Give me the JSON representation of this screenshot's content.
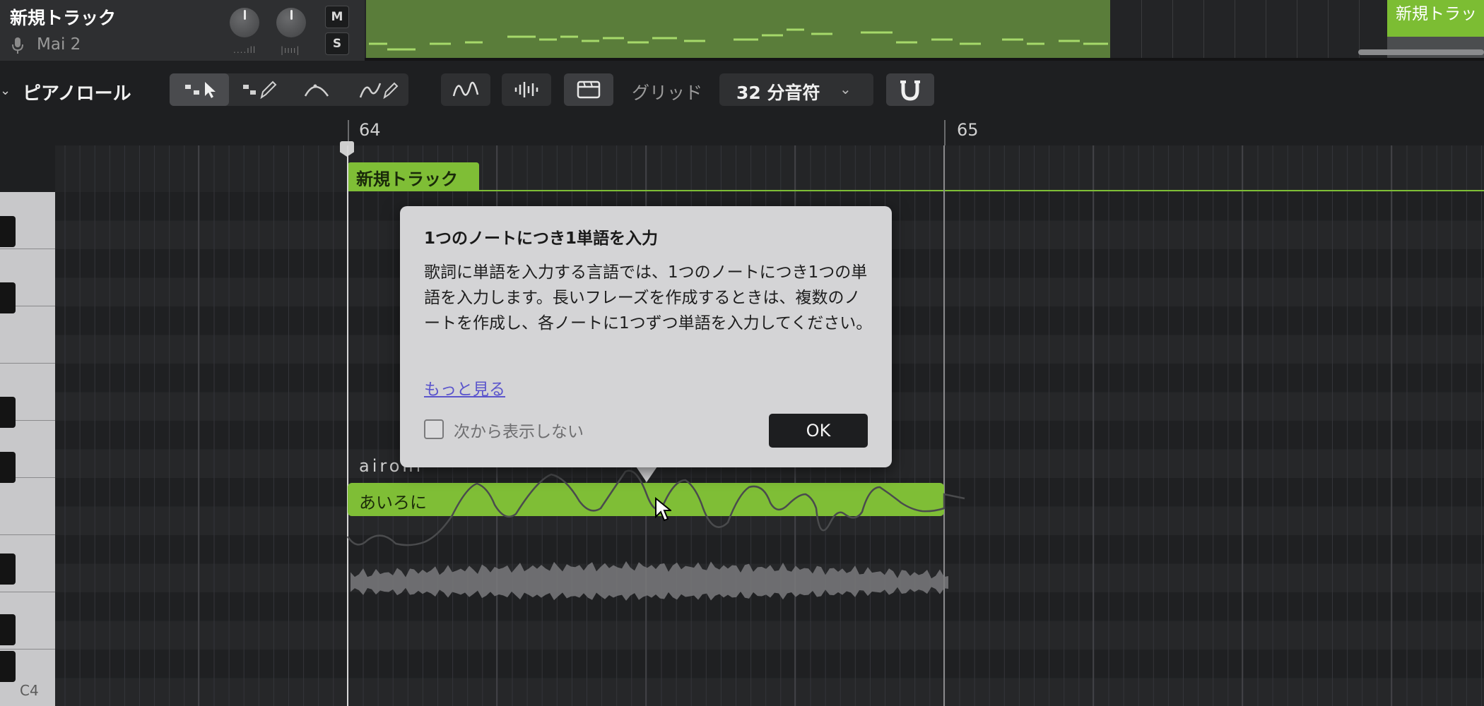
{
  "track": {
    "name": "新規トラック",
    "voice": "Mai 2",
    "mute_label": "M",
    "solo_label": "S",
    "volume_knob_ticks": "....ıll",
    "pan_knob_ticks": "|ıııı|"
  },
  "right_clip": {
    "label": "新規トラッ"
  },
  "piano_roll": {
    "collapse_icon": "chevron-down-icon",
    "title": "ピアノロール",
    "grid_label": "グリッド",
    "grid_value": "32 分音符",
    "grid_chevron": "⌄"
  },
  "ruler": {
    "bar_64": "64",
    "bar_65": "65"
  },
  "track_tab": {
    "label": "新規トラック"
  },
  "piano": {
    "c4_label": "C4"
  },
  "note": {
    "lyric": "あいろに",
    "phoneme": "aironi"
  },
  "popover": {
    "title": "1つのノートにつき1単語を入力",
    "body": "歌詞に単語を入力する言語では、1つのノートにつき1つの単語を入力します。長いフレーズを作成するときは、複数のノートを作成し、各ノートに1つずつ単語を入力してください。",
    "link": "もっと見る",
    "checkbox_label": "次から表示しない",
    "ok_label": "OK"
  },
  "colors": {
    "accent_green": "#7fbe36",
    "clip_green": "#5a7d3a",
    "popover_bg": "#d4d4d6",
    "link": "#5b55cc"
  },
  "icons": {
    "tools": [
      "select-note-tool-icon",
      "pencil-note-tool-icon",
      "pitch-curve-tool-icon",
      "pitch-pencil-tool-icon"
    ],
    "views": [
      "pitch-curve-view-icon",
      "waveform-view-icon",
      "clip-view-icon"
    ],
    "snap": "magnet-snap-icon"
  }
}
